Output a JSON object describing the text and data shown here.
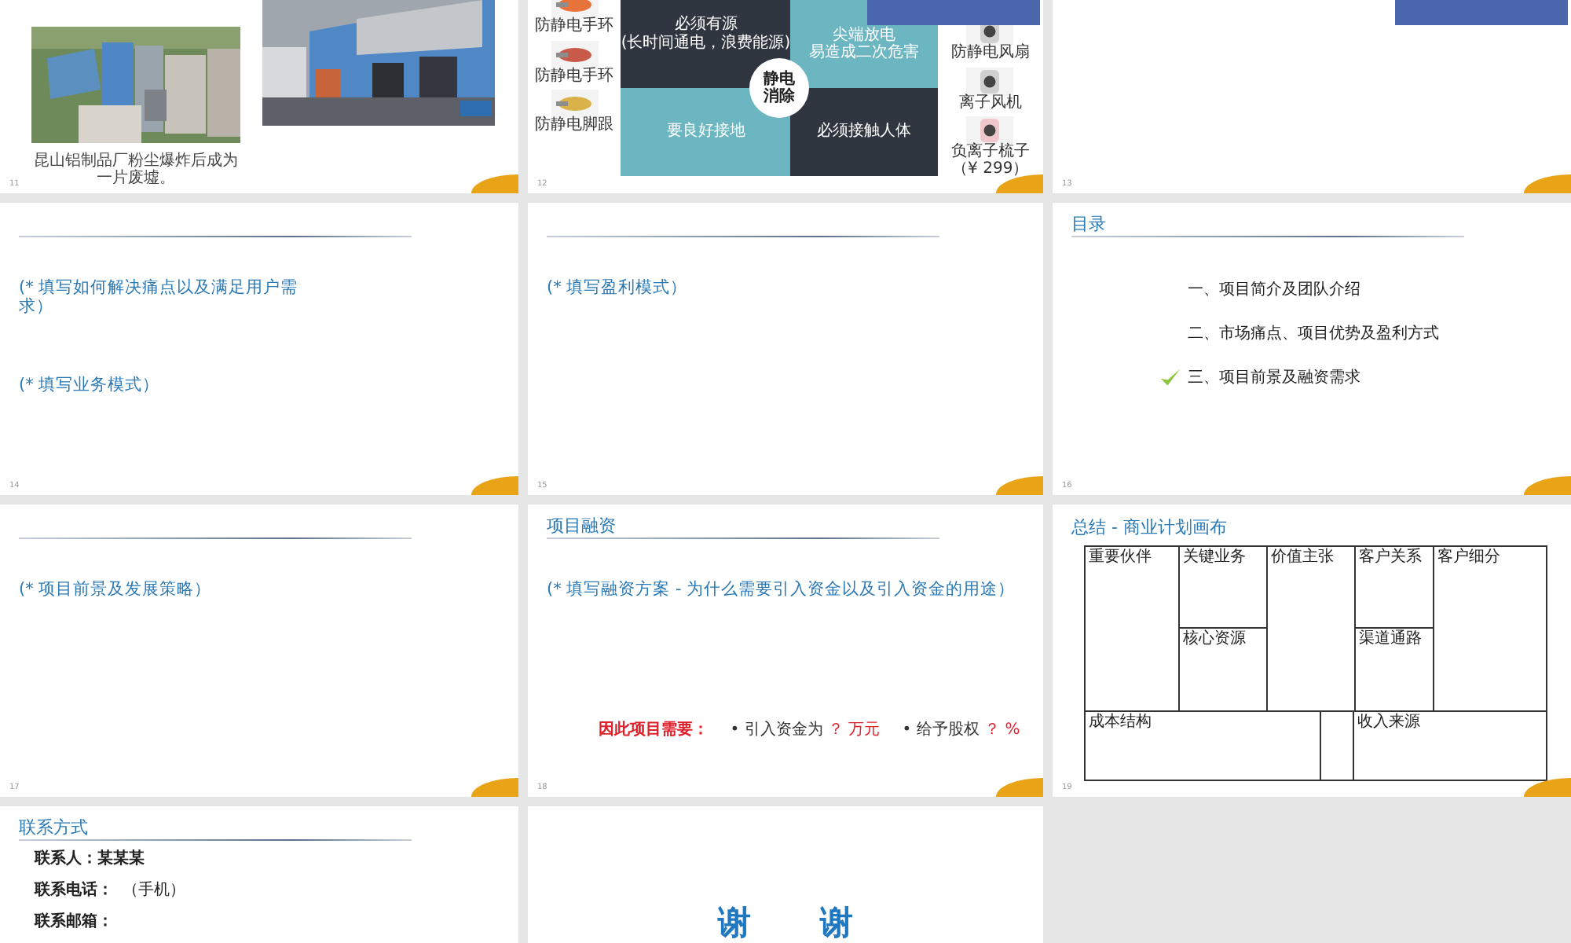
{
  "slides": [
    {
      "kind": "photos",
      "number": "11",
      "caption": "昆山铝制品厂粉尘爆炸后成为一片废墟。"
    },
    {
      "kind": "static",
      "number": "12",
      "banner": true,
      "center": [
        "静电",
        "消除"
      ],
      "quadrants": [
        {
          "lines": [
            "必须有源",
            "(长时间通电，浪费能源)"
          ],
          "color": "#2f3640"
        },
        {
          "lines": [
            "尖端放电",
            "易造成二次危害"
          ],
          "color": "#6cb6c2"
        },
        {
          "lines": [
            "要良好接地"
          ],
          "color": "#6cb6c2"
        },
        {
          "lines": [
            "必须接触人体"
          ],
          "color": "#2f3640"
        }
      ],
      "left_items": [
        {
          "label": "防静电手环"
        },
        {
          "label": "防静电手环"
        },
        {
          "label": "防静电脚跟"
        }
      ],
      "right_items": [
        {
          "label": "防静电风扇"
        },
        {
          "label": "离子风机"
        },
        {
          "label": "负离子梳子",
          "note": "（¥ 299）"
        }
      ]
    },
    {
      "kind": "blank",
      "number": "13",
      "banner": true
    },
    {
      "kind": "text",
      "number": "14",
      "paragraphs": [
        "(* 填写如何解决痛点以及满足用户需求）",
        "(* 填写业务模式）"
      ]
    },
    {
      "kind": "text",
      "number": "15",
      "paragraphs": [
        "(* 填写盈利模式）"
      ]
    },
    {
      "kind": "toc",
      "number": "16",
      "title": "目录",
      "items": [
        {
          "text": "一、项目简介及团队介绍",
          "selected": false
        },
        {
          "text": "二、市场痛点、项目优势及盈利方式",
          "selected": false
        },
        {
          "text": "三、项目前景及融资需求",
          "selected": true
        }
      ]
    },
    {
      "kind": "text",
      "number": "17",
      "paragraphs": [
        "(* 项目前景及发展策略）"
      ]
    },
    {
      "kind": "funding",
      "number": "18",
      "title": "项目融资",
      "paragraphs": [
        "(* 填写融资方案 - 为什么需要引入资金以及引入资金的用途）"
      ],
      "need_label": "因此项目需要：",
      "needs": [
        {
          "label": "• 引入资金为",
          "value": "？ 万元"
        },
        {
          "label": "• 给予股权",
          "value": "？ %"
        }
      ]
    },
    {
      "kind": "canvas",
      "number": "19",
      "title": "总结 - 商业计划画布",
      "cells": [
        "重要伙伴",
        "关键业务",
        "价值主张",
        "客户关系",
        "客户细分",
        "核心资源",
        "渠道通路",
        "成本结构",
        "收入来源"
      ]
    },
    {
      "kind": "contact",
      "title": "联系方式",
      "fields": [
        {
          "label": "联系人：",
          "value": "某某某"
        },
        {
          "label": "联系电话：",
          "value": "（手机）"
        },
        {
          "label": "联系邮箱："
        }
      ]
    },
    {
      "kind": "thanks",
      "chars": [
        "谢",
        "谢"
      ]
    }
  ]
}
